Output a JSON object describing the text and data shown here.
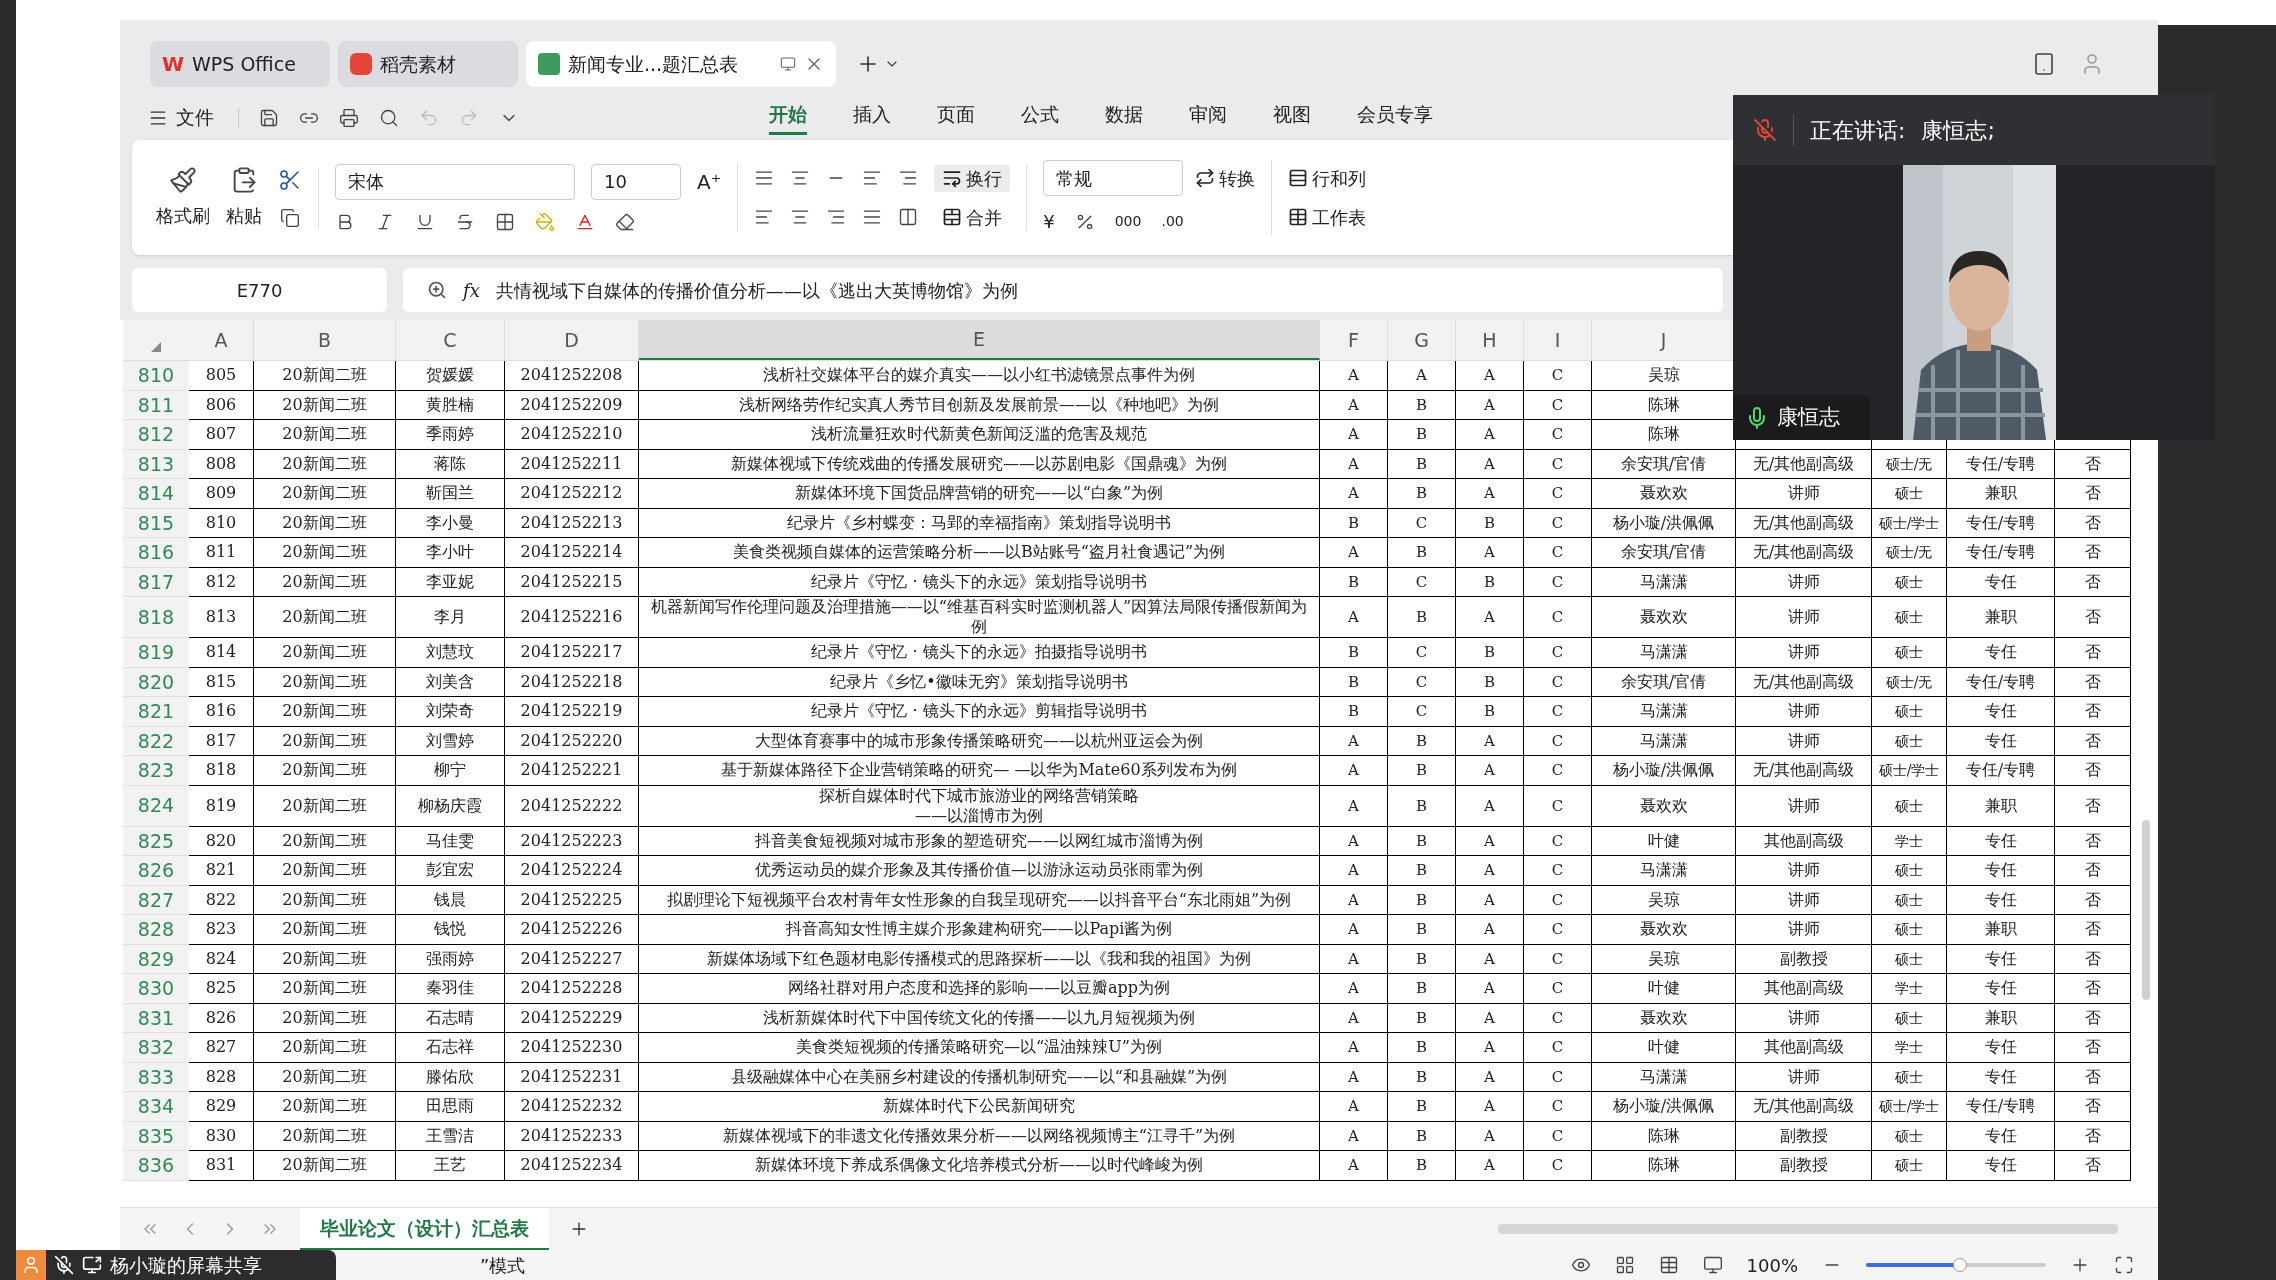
{
  "browser_tabs": [
    {
      "label": "WPS Office",
      "selected": false,
      "logo": "W"
    },
    {
      "label": "稻壳素材",
      "selected": false
    },
    {
      "label": "新闻专业...题汇总表",
      "selected": true
    }
  ],
  "menu": {
    "file": "文件"
  },
  "ribbon_tabs": [
    {
      "label": "开始",
      "selected": true
    },
    {
      "label": "插入",
      "selected": false
    },
    {
      "label": "页面",
      "selected": false
    },
    {
      "label": "公式",
      "selected": false
    },
    {
      "label": "数据",
      "selected": false
    },
    {
      "label": "审阅",
      "selected": false
    },
    {
      "label": "视图",
      "selected": false
    },
    {
      "label": "会员专享",
      "selected": false
    }
  ],
  "ribbon": {
    "format_painter": "格式刷",
    "paste": "粘贴",
    "font": "宋体",
    "font_size": "10",
    "wrap": "换行",
    "merge": "合并",
    "number_format": "常规",
    "convert": "转换",
    "rows_cols": "行和列",
    "worksheet": "工作表",
    "grow_font": "A⁺",
    "currency": "¥",
    "thousands": "000",
    "decimal": ".00"
  },
  "formula_bar": {
    "cell": "E770",
    "fx": "fx",
    "formula": "共情视域下自媒体的传播价值分析——以《逃出大英博物馆》为例"
  },
  "columns": [
    {
      "label": "A",
      "selected": false
    },
    {
      "label": "B",
      "selected": false
    },
    {
      "label": "C",
      "selected": false
    },
    {
      "label": "D",
      "selected": false
    },
    {
      "label": "E",
      "selected": true
    },
    {
      "label": "F",
      "selected": false
    },
    {
      "label": "G",
      "selected": false
    },
    {
      "label": "H",
      "selected": false
    },
    {
      "label": "I",
      "selected": false
    },
    {
      "label": "J",
      "selected": false
    }
  ],
  "rows": [
    {
      "number": "810",
      "cells": [
        "805",
        "20新闻二班",
        "贺媛媛",
        "2041252208",
        "浅析社交媒体平台的媒介真实——以小红书滤镜景点事件为例",
        "A",
        "A",
        "A",
        "C",
        "吴琼"
      ]
    },
    {
      "number": "811",
      "cells": [
        "806",
        "20新闻二班",
        "黄胜楠",
        "2041252209",
        "浅析网络劳作纪实真人秀节目创新及发展前景——以《种地吧》为例",
        "A",
        "B",
        "A",
        "C",
        "陈琳"
      ]
    },
    {
      "number": "812",
      "cells": [
        "807",
        "20新闻二班",
        "季雨婷",
        "2041252210",
        "浅析流量狂欢时代新黄色新闻泛滥的危害及规范",
        "A",
        "B",
        "A",
        "C",
        "陈琳"
      ]
    },
    {
      "number": "813",
      "cells": [
        "808",
        "20新闻二班",
        "蒋陈",
        "2041252211",
        "新媒体视域下传统戏曲的传播发展研究——以苏剧电影《国鼎魂》为例",
        "A",
        "B",
        "A",
        "C",
        "余安琪/官倩",
        "无/其他副高级",
        "硕士/无",
        "专任/专聘",
        "否"
      ]
    },
    {
      "number": "814",
      "cells": [
        "809",
        "20新闻二班",
        "靳国兰",
        "2041252212",
        "新媒体环境下国货品牌营销的研究——以“白象”为例",
        "A",
        "B",
        "A",
        "C",
        "聂欢欢",
        "讲师",
        "硕士",
        "兼职",
        "否"
      ]
    },
    {
      "number": "815",
      "cells": [
        "810",
        "20新闻二班",
        "李小曼",
        "2041252213",
        "纪录片《乡村蝶变：马郢的幸福指南》策划指导说明书",
        "B",
        "C",
        "B",
        "C",
        "杨小璇/洪佩佩",
        "无/其他副高级",
        "硕士/学士",
        "专任/专聘",
        "否"
      ]
    },
    {
      "number": "816",
      "cells": [
        "811",
        "20新闻二班",
        "李小叶",
        "2041252214",
        "美食类视频自媒体的运营策略分析——以B站账号“盗月社食遇记”为例",
        "A",
        "B",
        "A",
        "C",
        "余安琪/官倩",
        "无/其他副高级",
        "硕士/无",
        "专任/专聘",
        "否"
      ]
    },
    {
      "number": "817",
      "cells": [
        "812",
        "20新闻二班",
        "李亚妮",
        "2041252215",
        "纪录片《守忆 · 镜头下的永远》策划指导说明书",
        "B",
        "C",
        "B",
        "C",
        "马潇潇",
        "讲师",
        "硕士",
        "专任",
        "否"
      ]
    },
    {
      "number": "818",
      "cells": [
        "813",
        "20新闻二班",
        "李月",
        "2041252216",
        "机器新闻写作伦理问题及治理措施——以“维基百科实时监测机器人”因算法局限传播假新闻为例",
        "A",
        "B",
        "A",
        "C",
        "聂欢欢",
        "讲师",
        "硕士",
        "兼职",
        "否"
      ]
    },
    {
      "number": "819",
      "cells": [
        "814",
        "20新闻二班",
        "刘慧玟",
        "2041252217",
        "纪录片《守忆 · 镜头下的永远》拍摄指导说明书",
        "B",
        "C",
        "B",
        "C",
        "马潇潇",
        "讲师",
        "硕士",
        "专任",
        "否"
      ]
    },
    {
      "number": "820",
      "cells": [
        "815",
        "20新闻二班",
        "刘美含",
        "2041252218",
        "纪录片《乡忆•徽味无穷》策划指导说明书",
        "B",
        "C",
        "B",
        "C",
        "余安琪/官倩",
        "无/其他副高级",
        "硕士/无",
        "专任/专聘",
        "否"
      ]
    },
    {
      "number": "821",
      "cells": [
        "816",
        "20新闻二班",
        "刘荣奇",
        "2041252219",
        "纪录片《守忆 · 镜头下的永远》剪辑指导说明书",
        "B",
        "C",
        "B",
        "C",
        "马潇潇",
        "讲师",
        "硕士",
        "专任",
        "否"
      ]
    },
    {
      "number": "822",
      "cells": [
        "817",
        "20新闻二班",
        "刘雪婷",
        "2041252220",
        "大型体育赛事中的城市形象传播策略研究——以杭州亚运会为例",
        "A",
        "B",
        "A",
        "C",
        "马潇潇",
        "讲师",
        "硕士",
        "专任",
        "否"
      ]
    },
    {
      "number": "823",
      "cells": [
        "818",
        "20新闻二班",
        "柳宁",
        "2041252221",
        "基于新媒体路径下企业营销策略的研究— —以华为Mate60系列发布为例",
        "A",
        "B",
        "A",
        "C",
        "杨小璇/洪佩佩",
        "无/其他副高级",
        "硕士/学士",
        "专任/专聘",
        "否"
      ]
    },
    {
      "number": "824",
      "cells": [
        "819",
        "20新闻二班",
        "柳杨庆霞",
        "2041252222",
        "探析自媒体时代下城市旅游业的网络营销策略\n——以淄博市为例",
        "A",
        "B",
        "A",
        "C",
        "聂欢欢",
        "讲师",
        "硕士",
        "兼职",
        "否"
      ]
    },
    {
      "number": "825",
      "cells": [
        "820",
        "20新闻二班",
        "马佳雯",
        "2041252223",
        "抖音美食短视频对城市形象的塑造研究——以网红城市淄博为例",
        "A",
        "B",
        "A",
        "C",
        "叶健",
        "其他副高级",
        "学士",
        "专任",
        "否"
      ]
    },
    {
      "number": "826",
      "cells": [
        "821",
        "20新闻二班",
        "彭宜宏",
        "2041252224",
        "优秀运动员的媒介形象及其传播价值—以游泳运动员张雨霏为例",
        "A",
        "B",
        "A",
        "C",
        "马潇潇",
        "讲师",
        "硕士",
        "专任",
        "否"
      ]
    },
    {
      "number": "827",
      "cells": [
        "822",
        "20新闻二班",
        "钱晨",
        "2041252225",
        "拟剧理论下短视频平台农村青年女性形象的自我呈现研究——以抖音平台“东北雨姐”为例",
        "A",
        "B",
        "A",
        "C",
        "吴琼",
        "讲师",
        "硕士",
        "专任",
        "否"
      ]
    },
    {
      "number": "828",
      "cells": [
        "823",
        "20新闻二班",
        "钱悦",
        "2041252226",
        "抖音高知女性博主媒介形象建构研究——以Papi酱为例",
        "A",
        "B",
        "A",
        "C",
        "聂欢欢",
        "讲师",
        "硕士",
        "兼职",
        "否"
      ]
    },
    {
      "number": "829",
      "cells": [
        "824",
        "20新闻二班",
        "强雨婷",
        "2041252227",
        "新媒体场域下红色题材电影传播模式的思路探析——以《我和我的祖国》为例",
        "A",
        "B",
        "A",
        "C",
        "吴琼",
        "副教授",
        "硕士",
        "专任",
        "否"
      ]
    },
    {
      "number": "830",
      "cells": [
        "825",
        "20新闻二班",
        "秦羽佳",
        "2041252228",
        "网络社群对用户态度和选择的影响——以豆瓣app为例",
        "A",
        "B",
        "A",
        "C",
        "叶健",
        "其他副高级",
        "学士",
        "专任",
        "否"
      ]
    },
    {
      "number": "831",
      "cells": [
        "826",
        "20新闻二班",
        "石志晴",
        "2041252229",
        "浅析新媒体时代下中国传统文化的传播——以九月短视频为例",
        "A",
        "B",
        "A",
        "C",
        "聂欢欢",
        "讲师",
        "硕士",
        "兼职",
        "否"
      ]
    },
    {
      "number": "832",
      "cells": [
        "827",
        "20新闻二班",
        "石志祥",
        "2041252230",
        "美食类短视频的传播策略研究—以“温油辣辣U”为例",
        "A",
        "B",
        "A",
        "C",
        "叶健",
        "其他副高级",
        "学士",
        "专任",
        "否"
      ]
    },
    {
      "number": "833",
      "cells": [
        "828",
        "20新闻二班",
        "滕佑欣",
        "2041252231",
        "县级融媒体中心在美丽乡村建设的传播机制研究——以“和县融媒”为例",
        "A",
        "B",
        "A",
        "C",
        "马潇潇",
        "讲师",
        "硕士",
        "专任",
        "否"
      ]
    },
    {
      "number": "834",
      "cells": [
        "829",
        "20新闻二班",
        "田思雨",
        "2041252232",
        "新媒体时代下公民新闻研究",
        "A",
        "B",
        "A",
        "C",
        "杨小璇/洪佩佩",
        "无/其他副高级",
        "硕士/学士",
        "专任/专聘",
        "否"
      ]
    },
    {
      "number": "835",
      "cells": [
        "830",
        "20新闻二班",
        "王雪洁",
        "2041252233",
        "新媒体视域下的非遗文化传播效果分析——以网络视频博主“江寻千”为例",
        "A",
        "B",
        "A",
        "C",
        "陈琳",
        "副教授",
        "硕士",
        "专任",
        "否"
      ]
    },
    {
      "number": "836",
      "cells": [
        "831",
        "20新闻二班",
        "王艺",
        "2041252234",
        "新媒体环境下养成系偶像文化培养模式分析——以时代峰峻为例",
        "A",
        "B",
        "A",
        "C",
        "陈琳",
        "副教授",
        "硕士",
        "专任",
        "否"
      ]
    }
  ],
  "sheet_tabs": [
    {
      "label": "毕业论文（设计）汇总表",
      "selected": true
    }
  ],
  "status_bar": {
    "mode_text": "”模式",
    "zoom": "100%",
    "zoom_slider": {
      "level": 0.52
    }
  },
  "meeting": {
    "speaking_label": "正在讲话:",
    "speaker": "康恒志;",
    "video_name": "康恒志",
    "share_label": "杨小璇的屏幕共享"
  }
}
